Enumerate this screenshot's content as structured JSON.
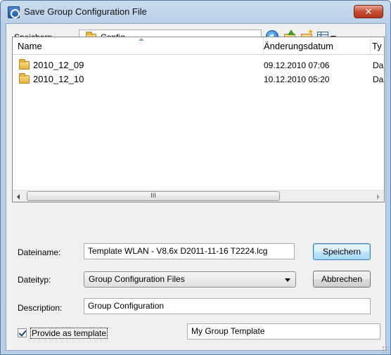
{
  "window": {
    "title": "Save Group Configuration File",
    "close_glyph": "✕"
  },
  "toolbar": {
    "save_in_label": "Speichern",
    "save_in_value": "Config",
    "icons": [
      "back-icon",
      "up-folder-icon",
      "new-folder-icon",
      "views-menu-icon"
    ]
  },
  "file_list": {
    "columns": [
      "Name",
      "Änderungsdatum",
      "Ty"
    ],
    "rows": [
      {
        "name": "2010_12_09",
        "date": "09.12.2010 07:06",
        "type": "Da"
      },
      {
        "name": "2010_12_10",
        "date": "10.12.2010 05:20",
        "type": "Da"
      }
    ],
    "scroll_thumb": "III"
  },
  "form": {
    "filename_label": "Dateiname:",
    "filename_value": "Template WLAN - V8.6x D2011-11-16 T2224.lcg",
    "filetype_label": "Dateityp:",
    "filetype_value": "Group Configuration Files",
    "description_label": "Description:",
    "description_value": "Group Configuration",
    "template_checkbox_label": "Provide as template",
    "template_checked": true,
    "template_name_value": "My Group Template"
  },
  "buttons": {
    "save": "Speichern",
    "cancel": "Abbrechen"
  },
  "colors": {
    "title_bar": "#c9dbee",
    "close_button": "#c74d32",
    "dialog_bg": "#f0f0f0"
  }
}
